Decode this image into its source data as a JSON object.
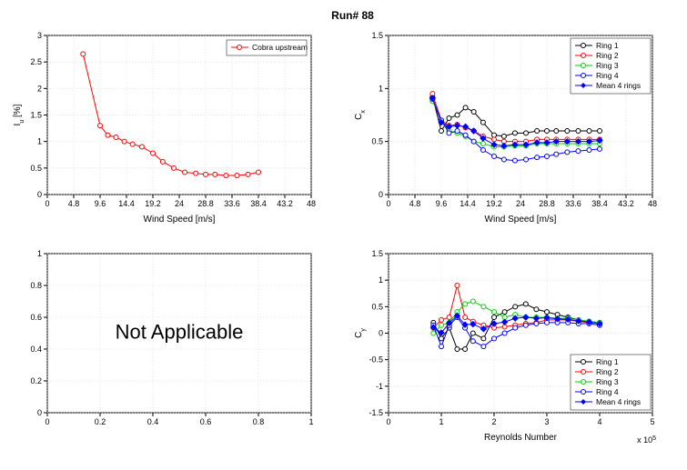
{
  "title": "Run# 88",
  "chart_data": [
    {
      "type": "line",
      "title": "",
      "xlabel": "Wind Speed [m/s]",
      "ylabel": "I_u [%]",
      "xlim": [
        0,
        48
      ],
      "ylim": [
        0,
        3
      ],
      "xticks": [
        0,
        4.8,
        9.6,
        14.4,
        19.2,
        24,
        28.8,
        33.6,
        38.4,
        43.2,
        48
      ],
      "yticks": [
        0,
        0.5,
        1,
        1.5,
        2,
        2.5,
        3
      ],
      "series": [
        {
          "name": "Cobra upstream",
          "color": "#ff0000",
          "marker": "o",
          "x": [
            6.5,
            9.6,
            11,
            12.5,
            14,
            15.5,
            17.2,
            19.2,
            21,
            23,
            25,
            27,
            28.8,
            30.5,
            32.5,
            34.5,
            36.5,
            38.4
          ],
          "y": [
            2.65,
            1.3,
            1.12,
            1.08,
            1.0,
            0.95,
            0.9,
            0.78,
            0.62,
            0.5,
            0.42,
            0.4,
            0.38,
            0.38,
            0.36,
            0.36,
            0.38,
            0.42
          ]
        }
      ]
    },
    {
      "type": "line",
      "title": "",
      "xlabel": "Wind Speed [m/s]",
      "ylabel": "C_x",
      "xlim": [
        0,
        48
      ],
      "ylim": [
        0,
        1.5
      ],
      "xticks": [
        0,
        4.8,
        9.6,
        14.4,
        19.2,
        24,
        28.8,
        33.6,
        38.4,
        43.2,
        48
      ],
      "yticks": [
        0,
        0.5,
        1,
        1.5
      ],
      "series": [
        {
          "name": "Ring 1",
          "color": "#000000",
          "marker": "o",
          "x": [
            8,
            9.6,
            11,
            12.5,
            14,
            15.5,
            17.2,
            19.2,
            21,
            23,
            25,
            27,
            28.8,
            30.5,
            32.5,
            34.5,
            36.5,
            38.4
          ],
          "y": [
            0.92,
            0.6,
            0.72,
            0.75,
            0.82,
            0.78,
            0.68,
            0.56,
            0.55,
            0.58,
            0.58,
            0.6,
            0.6,
            0.6,
            0.6,
            0.6,
            0.6,
            0.6
          ]
        },
        {
          "name": "Ring 2",
          "color": "#ff0000",
          "marker": "o",
          "x": [
            8,
            9.6,
            11,
            12.5,
            14,
            15.5,
            17.2,
            19.2,
            21,
            23,
            25,
            27,
            28.8,
            30.5,
            32.5,
            34.5,
            36.5,
            38.4
          ],
          "y": [
            0.95,
            0.7,
            0.65,
            0.66,
            0.63,
            0.6,
            0.55,
            0.52,
            0.5,
            0.5,
            0.5,
            0.52,
            0.52,
            0.52,
            0.52,
            0.52,
            0.52,
            0.52
          ]
        },
        {
          "name": "Ring 3",
          "color": "#00d000",
          "marker": "o",
          "x": [
            8,
            9.6,
            11,
            12.5,
            14,
            15.5,
            17.2,
            19.2,
            21,
            23,
            25,
            27,
            28.8,
            30.5,
            32.5,
            34.5,
            36.5,
            38.4
          ],
          "y": [
            0.88,
            0.7,
            0.6,
            0.58,
            0.55,
            0.5,
            0.48,
            0.45,
            0.45,
            0.46,
            0.46,
            0.48,
            0.48,
            0.48,
            0.48,
            0.48,
            0.48,
            0.48
          ]
        },
        {
          "name": "Ring 4",
          "color": "#0000ff",
          "marker": "o",
          "x": [
            8,
            9.6,
            11,
            12.5,
            14,
            15.5,
            17.2,
            19.2,
            21,
            23,
            25,
            27,
            28.8,
            30.5,
            32.5,
            34.5,
            36.5,
            38.4
          ],
          "y": [
            0.9,
            0.7,
            0.58,
            0.6,
            0.56,
            0.5,
            0.42,
            0.36,
            0.33,
            0.32,
            0.33,
            0.35,
            0.36,
            0.38,
            0.4,
            0.41,
            0.42,
            0.43
          ]
        },
        {
          "name": "Mean 4 rings",
          "color": "#0000ff",
          "marker": "diamond-filled",
          "x": [
            8,
            9.6,
            11,
            12.5,
            14,
            15.5,
            17.2,
            19.2,
            21,
            23,
            25,
            27,
            28.8,
            30.5,
            32.5,
            34.5,
            36.5,
            38.4
          ],
          "y": [
            0.91,
            0.68,
            0.64,
            0.65,
            0.64,
            0.6,
            0.53,
            0.47,
            0.46,
            0.47,
            0.47,
            0.49,
            0.49,
            0.5,
            0.5,
            0.5,
            0.5,
            0.51
          ]
        }
      ]
    },
    {
      "type": "empty",
      "text": "Not Applicable",
      "xlim": [
        0,
        1
      ],
      "ylim": [
        0,
        1
      ],
      "xticks": [
        0,
        0.2,
        0.4,
        0.6,
        0.8,
        1
      ],
      "yticks": [
        0,
        0.2,
        0.4,
        0.6,
        0.8,
        1
      ]
    },
    {
      "type": "line",
      "title": "",
      "xlabel": "Reynolds Number",
      "ylabel": "C_y",
      "xlim": [
        0,
        5
      ],
      "ylim": [
        -1.5,
        1.5
      ],
      "x_scale_note": "x 10^5",
      "xticks": [
        0,
        1,
        2,
        3,
        4,
        5
      ],
      "yticks": [
        -1.5,
        -1,
        -0.5,
        0,
        0.5,
        1,
        1.5
      ],
      "series": [
        {
          "name": "Ring 1",
          "color": "#000000",
          "marker": "o",
          "x": [
            0.85,
            1.0,
            1.15,
            1.3,
            1.45,
            1.6,
            1.8,
            2.0,
            2.2,
            2.4,
            2.6,
            2.8,
            3.0,
            3.2,
            3.4,
            3.6,
            3.8,
            4.0
          ],
          "y": [
            0.2,
            -0.1,
            0.1,
            -0.3,
            -0.3,
            0.0,
            -0.1,
            0.3,
            0.4,
            0.5,
            0.55,
            0.45,
            0.4,
            0.35,
            0.3,
            0.25,
            0.22,
            0.2
          ]
        },
        {
          "name": "Ring 2",
          "color": "#ff0000",
          "marker": "o",
          "x": [
            0.85,
            1.0,
            1.15,
            1.3,
            1.45,
            1.6,
            1.8,
            2.0,
            2.2,
            2.4,
            2.6,
            2.8,
            3.0,
            3.2,
            3.4,
            3.6,
            3.8,
            4.0
          ],
          "y": [
            0.1,
            0.25,
            0.3,
            0.9,
            0.3,
            0.22,
            0.15,
            0.1,
            0.12,
            0.15,
            0.18,
            0.2,
            0.25,
            0.25,
            0.25,
            0.22,
            0.2,
            0.18
          ]
        },
        {
          "name": "Ring 3",
          "color": "#00d000",
          "marker": "o",
          "x": [
            0.85,
            1.0,
            1.15,
            1.3,
            1.45,
            1.6,
            1.8,
            2.0,
            2.2,
            2.4,
            2.6,
            2.8,
            3.0,
            3.2,
            3.4,
            3.6,
            3.8,
            4.0
          ],
          "y": [
            0.0,
            0.15,
            0.2,
            0.4,
            0.55,
            0.6,
            0.5,
            0.4,
            0.3,
            0.35,
            0.3,
            0.3,
            0.3,
            0.28,
            0.28,
            0.25,
            0.22,
            0.2
          ]
        },
        {
          "name": "Ring 4",
          "color": "#0000ff",
          "marker": "o",
          "x": [
            0.85,
            1.0,
            1.15,
            1.3,
            1.45,
            1.6,
            1.8,
            2.0,
            2.2,
            2.4,
            2.6,
            2.8,
            3.0,
            3.2,
            3.4,
            3.6,
            3.8,
            4.0
          ],
          "y": [
            0.15,
            -0.25,
            0.15,
            0.3,
            0.1,
            -0.15,
            -0.25,
            -0.1,
            0.0,
            0.1,
            0.15,
            0.18,
            0.2,
            0.2,
            0.2,
            0.18,
            0.18,
            0.15
          ]
        },
        {
          "name": "Mean 4 rings",
          "color": "#0000ff",
          "marker": "diamond-filled",
          "x": [
            0.85,
            1.0,
            1.15,
            1.3,
            1.45,
            1.6,
            1.8,
            2.0,
            2.2,
            2.4,
            2.6,
            2.8,
            3.0,
            3.2,
            3.4,
            3.6,
            3.8,
            4.0
          ],
          "y": [
            0.11,
            0.01,
            0.19,
            0.33,
            0.16,
            0.17,
            0.08,
            0.18,
            0.21,
            0.28,
            0.3,
            0.28,
            0.29,
            0.27,
            0.26,
            0.23,
            0.21,
            0.18
          ]
        }
      ]
    }
  ]
}
